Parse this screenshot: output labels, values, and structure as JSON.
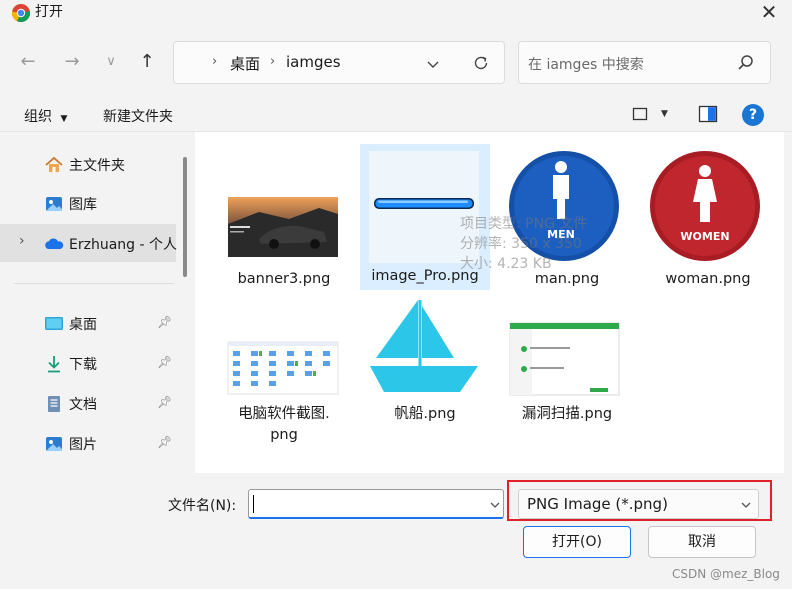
{
  "window": {
    "title": "打开"
  },
  "address": {
    "crumbs": [
      "桌面",
      "iamges"
    ]
  },
  "search": {
    "placeholder": "在 iamges 中搜索"
  },
  "toolbar": {
    "organize": "组织",
    "new_folder": "新建文件夹",
    "help": "?"
  },
  "sidebar": {
    "items": [
      {
        "label": "主文件夹"
      },
      {
        "label": "图库"
      },
      {
        "label": "Erzhuang - 个人"
      },
      {
        "label": "桌面"
      },
      {
        "label": "下载"
      },
      {
        "label": "文档"
      },
      {
        "label": "图片"
      }
    ]
  },
  "files": [
    {
      "name": "banner3.png"
    },
    {
      "name": "image_Pro.png"
    },
    {
      "name": "man.png",
      "thumb_text": "MEN"
    },
    {
      "name": "woman.png",
      "thumb_text": "WOMEN"
    },
    {
      "name": "电脑软件截图.\npng"
    },
    {
      "name": "帆船.png"
    },
    {
      "name": "漏洞扫描.png"
    }
  ],
  "tooltip": {
    "line1": "项目类型: PNG 文件",
    "line2": "分辨率: 350 x 350",
    "line3": "大小: 4.23 KB"
  },
  "footer": {
    "filename_label": "文件名(N):",
    "filename_value": "",
    "filetype": "PNG Image (*.png)",
    "open": "打开(O)",
    "cancel": "取消"
  },
  "watermark": "CSDN @mez_Blog",
  "colors": {
    "accent": "#1a73e8",
    "highlight_box": "#e0202a",
    "selected_bg": "#dbeeff"
  }
}
